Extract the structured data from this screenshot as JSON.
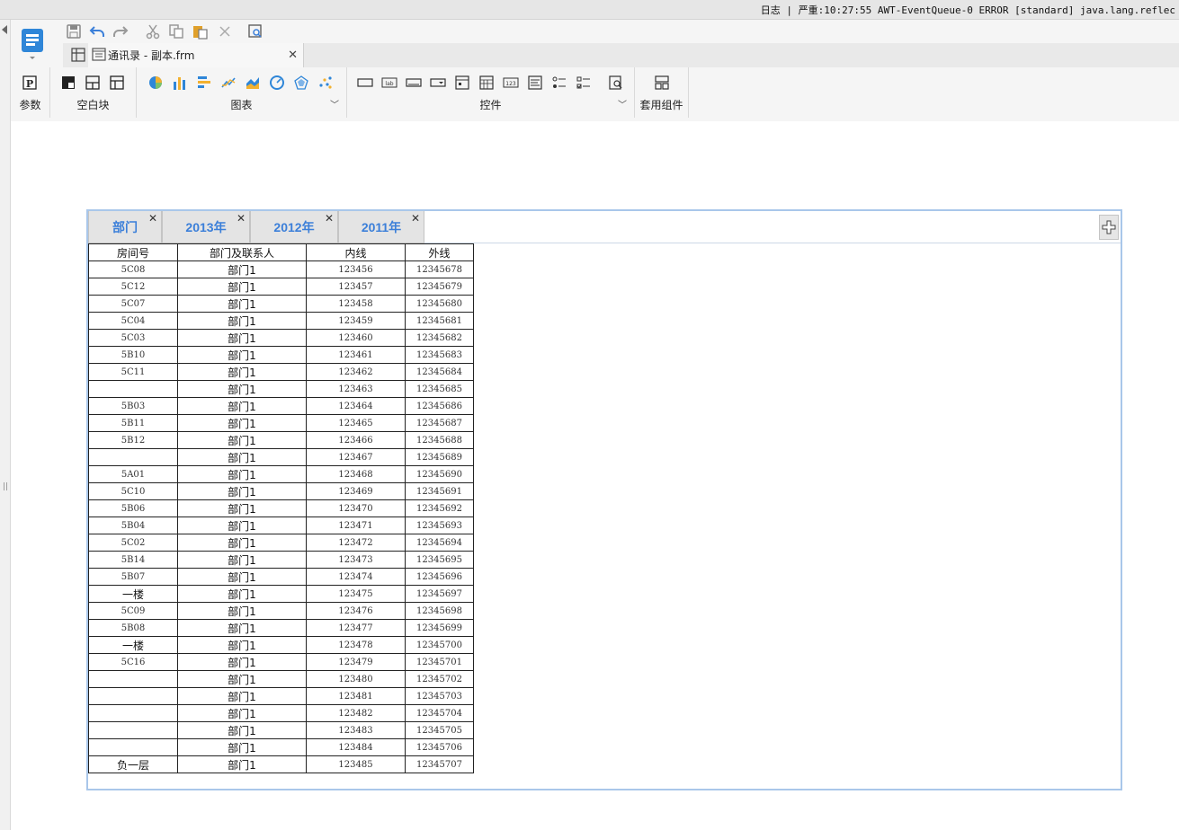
{
  "log_bar": {
    "text": "日志 | 严重:10:27:55 AWT-EventQueue-0 ERROR [standard] java.lang.reflec"
  },
  "file_tab": {
    "label": "通讯录 - 副本.frm",
    "close": "✕"
  },
  "ribbon": {
    "groups": [
      {
        "label": "参数"
      },
      {
        "label": "空白块"
      },
      {
        "label": "图表"
      },
      {
        "label": "控件"
      },
      {
        "label": "套用组件"
      }
    ]
  },
  "sheet_tabs": [
    {
      "label": "部门",
      "close": "✕"
    },
    {
      "label": "2013年",
      "close": "✕"
    },
    {
      "label": "2012年",
      "close": "✕"
    },
    {
      "label": "2011年",
      "close": "✕"
    }
  ],
  "table": {
    "headers": [
      "房间号",
      "部门及联系人",
      "内线",
      "外线"
    ],
    "rows": [
      [
        "5C08",
        "部门1",
        "123456",
        "12345678"
      ],
      [
        "5C12",
        "部门1",
        "123457",
        "12345679"
      ],
      [
        "5C07",
        "部门1",
        "123458",
        "12345680"
      ],
      [
        "5C04",
        "部门1",
        "123459",
        "12345681"
      ],
      [
        "5C03",
        "部门1",
        "123460",
        "12345682"
      ],
      [
        "5B10",
        "部门1",
        "123461",
        "12345683"
      ],
      [
        "5C11",
        "部门1",
        "123462",
        "12345684"
      ],
      [
        "",
        "部门1",
        "123463",
        "12345685"
      ],
      [
        "5B03",
        "部门1",
        "123464",
        "12345686"
      ],
      [
        "5B11",
        "部门1",
        "123465",
        "12345687"
      ],
      [
        "5B12",
        "部门1",
        "123466",
        "12345688"
      ],
      [
        "",
        "部门1",
        "123467",
        "12345689"
      ],
      [
        "5A01",
        "部门1",
        "123468",
        "12345690"
      ],
      [
        "5C10",
        "部门1",
        "123469",
        "12345691"
      ],
      [
        "5B06",
        "部门1",
        "123470",
        "12345692"
      ],
      [
        "5B04",
        "部门1",
        "123471",
        "12345693"
      ],
      [
        "5C02",
        "部门1",
        "123472",
        "12345694"
      ],
      [
        "5B14",
        "部门1",
        "123473",
        "12345695"
      ],
      [
        "5B07",
        "部门1",
        "123474",
        "12345696"
      ],
      [
        "一楼",
        "部门1",
        "123475",
        "12345697"
      ],
      [
        "5C09",
        "部门1",
        "123476",
        "12345698"
      ],
      [
        "5B08",
        "部门1",
        "123477",
        "12345699"
      ],
      [
        "一楼",
        "部门1",
        "123478",
        "12345700"
      ],
      [
        "5C16",
        "部门1",
        "123479",
        "12345701"
      ],
      [
        "",
        "部门1",
        "123480",
        "12345702"
      ],
      [
        "",
        "部门1",
        "123481",
        "12345703"
      ],
      [
        "",
        "部门1",
        "123482",
        "12345704"
      ],
      [
        "",
        "部门1",
        "123483",
        "12345705"
      ],
      [
        "",
        "部门1",
        "123484",
        "12345706"
      ],
      [
        "负一层",
        "部门1",
        "123485",
        "12345707"
      ]
    ]
  },
  "colors": {
    "accent": "#3b7fd9",
    "frame_border": "#a9c7ea",
    "tab_bg": "#e4e4e4"
  },
  "icons": [
    "app-logo-icon",
    "save-icon",
    "undo-icon",
    "redo-icon",
    "cut-icon",
    "copy-icon",
    "paste-icon",
    "delete-icon",
    "preview-icon",
    "param-icon",
    "pie-chart-icon",
    "bar-chart-icon",
    "line-chart-icon",
    "radar-chart-icon",
    "add-tab-icon"
  ]
}
